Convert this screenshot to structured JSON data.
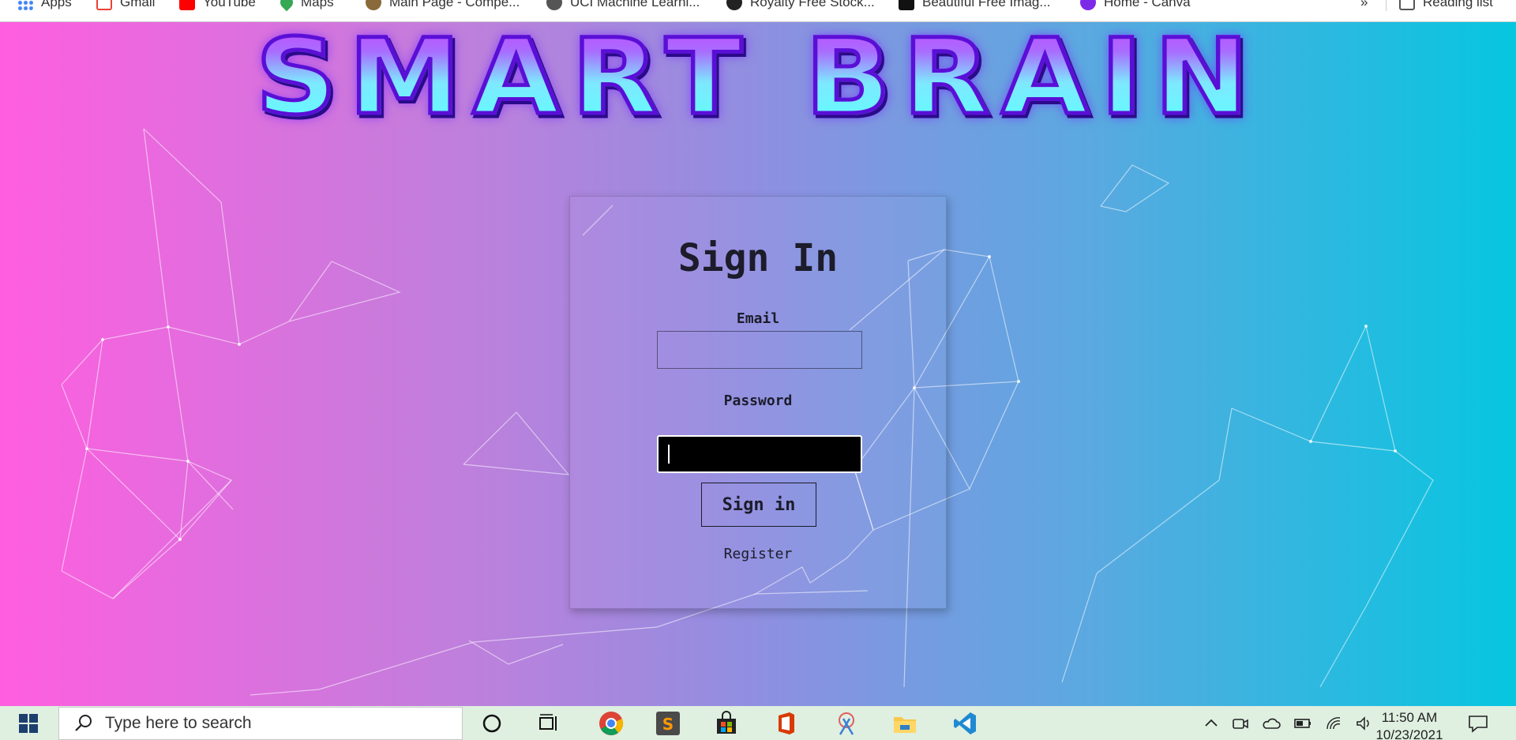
{
  "bookmarks_bar": {
    "items": [
      {
        "label": "Apps",
        "icon": "apps-grid-icon",
        "color": "#4285f4"
      },
      {
        "label": "Gmail",
        "icon": "gmail-icon",
        "color": "#ea4335"
      },
      {
        "label": "YouTube",
        "icon": "youtube-icon",
        "color": "#ff0000"
      },
      {
        "label": "Maps",
        "icon": "maps-pin-icon",
        "color": "#34a853"
      },
      {
        "label": "Main Page - Compe...",
        "icon": "site-favicon",
        "color": "#8a6a3a"
      },
      {
        "label": "UCI Machine Learni...",
        "icon": "site-favicon",
        "color": "#555555"
      },
      {
        "label": "Royalty Free Stock...",
        "icon": "site-favicon",
        "color": "#222222"
      },
      {
        "label": "Beautiful Free Imag...",
        "icon": "site-favicon",
        "color": "#111111"
      },
      {
        "label": "Home - Canva",
        "icon": "canva-icon",
        "color": "#7d2ae8"
      }
    ],
    "overflow": "»",
    "reading_list": "Reading list"
  },
  "app": {
    "logo_text": "SMART BRAIN"
  },
  "signin": {
    "title": "Sign In",
    "email_label": "Email",
    "email_value": "",
    "password_label": "Password",
    "password_value": "",
    "submit_label": "Sign in",
    "register_label": "Register"
  },
  "taskbar": {
    "search_placeholder": "Type here to search",
    "time": "11:50 AM",
    "date": "10/23/2021"
  },
  "colors": {
    "gradient_left": "#ff5edf",
    "gradient_right": "#06c6e0",
    "logo_fill": "#5cffff",
    "logo_stroke": "#5a0fd6"
  }
}
